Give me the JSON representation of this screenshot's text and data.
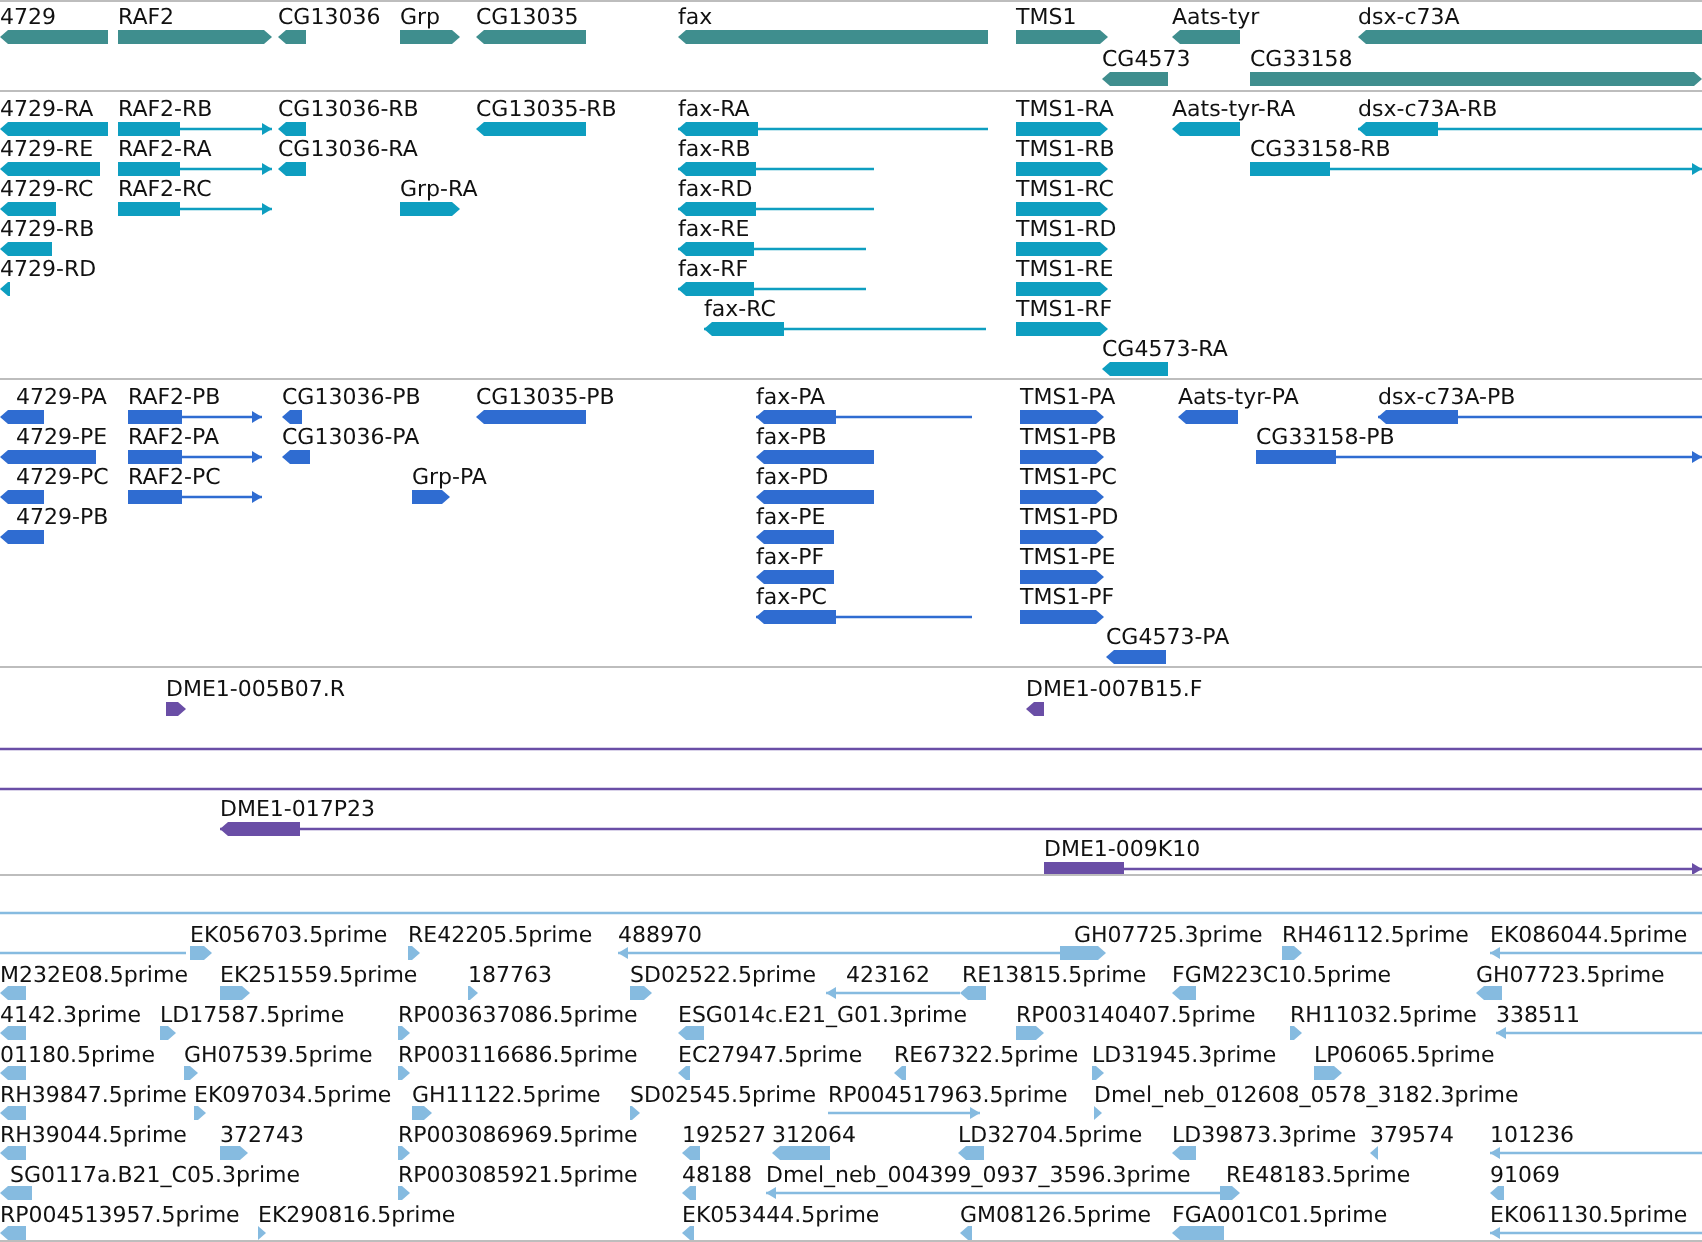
{
  "tracks": [
    {
      "kind": "gene",
      "color": "#3f8e8e",
      "features": [
        {
          "label": "4729",
          "reverse": true
        },
        {
          "label": "RAF2",
          "reverse": false
        },
        {
          "label": "CG13036",
          "reverse": true
        },
        {
          "label": "Grp",
          "reverse": false
        },
        {
          "label": "CG13035",
          "reverse": true
        },
        {
          "label": "fax",
          "reverse": true
        },
        {
          "label": "TMS1",
          "reverse": false
        },
        {
          "label": "Aats-tyr",
          "reverse": true
        },
        {
          "label": "dsx-c73A",
          "reverse": true
        },
        {
          "label": "CG4573",
          "reverse": true
        },
        {
          "label": "CG33158",
          "reverse": false
        }
      ]
    },
    {
      "kind": "transcript",
      "color": "#0e9ec0",
      "features": [
        {
          "label": "4729-RA",
          "reverse": true
        },
        {
          "label": "RAF2-RB",
          "reverse": false
        },
        {
          "label": "CG13036-RB",
          "reverse": true
        },
        {
          "label": "CG13035-RB",
          "reverse": true
        },
        {
          "label": "fax-RA",
          "reverse": true
        },
        {
          "label": "TMS1-RA",
          "reverse": false
        },
        {
          "label": "Aats-tyr-RA",
          "reverse": true
        },
        {
          "label": "dsx-c73A-RB",
          "reverse": true
        },
        {
          "label": "4729-RE",
          "reverse": true
        },
        {
          "label": "RAF2-RA",
          "reverse": false
        },
        {
          "label": "CG13036-RA",
          "reverse": true
        },
        {
          "label": "fax-RB",
          "reverse": true
        },
        {
          "label": "TMS1-RB",
          "reverse": false
        },
        {
          "label": "CG33158-RB",
          "reverse": false
        },
        {
          "label": "4729-RC",
          "reverse": true
        },
        {
          "label": "RAF2-RC",
          "reverse": false
        },
        {
          "label": "Grp-RA",
          "reverse": false
        },
        {
          "label": "fax-RD",
          "reverse": true
        },
        {
          "label": "TMS1-RC",
          "reverse": false
        },
        {
          "label": "4729-RB",
          "reverse": true
        },
        {
          "label": "fax-RE",
          "reverse": true
        },
        {
          "label": "TMS1-RD",
          "reverse": false
        },
        {
          "label": "4729-RD",
          "reverse": true
        },
        {
          "label": "fax-RF",
          "reverse": true
        },
        {
          "label": "TMS1-RE",
          "reverse": false
        },
        {
          "label": "fax-RC",
          "reverse": true
        },
        {
          "label": "TMS1-RF",
          "reverse": false
        },
        {
          "label": "CG4573-RA",
          "reverse": true
        }
      ]
    },
    {
      "kind": "protein",
      "color": "#2f6cd1",
      "features": [
        {
          "label": "4729-PA",
          "reverse": true
        },
        {
          "label": "RAF2-PB",
          "reverse": false
        },
        {
          "label": "CG13036-PB",
          "reverse": true
        },
        {
          "label": "CG13035-PB",
          "reverse": true
        },
        {
          "label": "fax-PA",
          "reverse": true
        },
        {
          "label": "TMS1-PA",
          "reverse": false
        },
        {
          "label": "Aats-tyr-PA",
          "reverse": true
        },
        {
          "label": "dsx-c73A-PB",
          "reverse": true
        },
        {
          "label": "4729-PE",
          "reverse": true
        },
        {
          "label": "RAF2-PA",
          "reverse": false
        },
        {
          "label": "CG13036-PA",
          "reverse": true
        },
        {
          "label": "fax-PB",
          "reverse": true
        },
        {
          "label": "TMS1-PB",
          "reverse": false
        },
        {
          "label": "CG33158-PB",
          "reverse": false
        },
        {
          "label": "4729-PC",
          "reverse": true
        },
        {
          "label": "RAF2-PC",
          "reverse": false
        },
        {
          "label": "Grp-PA",
          "reverse": false
        },
        {
          "label": "fax-PD",
          "reverse": true
        },
        {
          "label": "TMS1-PC",
          "reverse": false
        },
        {
          "label": "4729-PB",
          "reverse": true
        },
        {
          "label": "fax-PE",
          "reverse": true
        },
        {
          "label": "TMS1-PD",
          "reverse": false
        },
        {
          "label": "fax-PF",
          "reverse": true
        },
        {
          "label": "TMS1-PE",
          "reverse": false
        },
        {
          "label": "fax-PC",
          "reverse": true
        },
        {
          "label": "TMS1-PF",
          "reverse": false
        },
        {
          "label": "CG4573-PA",
          "reverse": true
        }
      ]
    },
    {
      "kind": "clone",
      "color": "#6a4ea6",
      "features": [
        {
          "kind": "feature",
          "label": "DME1-005B07.R",
          "reverse": false
        },
        {
          "kind": "feature",
          "label": "DME1-007B15.F",
          "reverse": true
        },
        {
          "kind": "span"
        },
        {
          "kind": "span"
        },
        {
          "kind": "feature",
          "label": "DME1-017P23",
          "reverse": true
        },
        {
          "kind": "feature",
          "label": "DME1-009K10",
          "reverse": false
        }
      ]
    },
    {
      "kind": "est",
      "color": "#86bbe0",
      "features": [
        {
          "kind": "span"
        },
        {
          "kind": "span"
        },
        {
          "kind": "feature",
          "label": "EK056703.5prime",
          "reverse": false
        },
        {
          "kind": "feature",
          "label": "RE42205.5prime",
          "reverse": false
        },
        {
          "kind": "feature",
          "label": "488970",
          "reverse": true
        },
        {
          "kind": "feature",
          "label": "GH07725.3prime",
          "reverse": false
        },
        {
          "kind": "feature",
          "label": "RH46112.5prime",
          "reverse": false
        },
        {
          "kind": "feature",
          "label": "EK086044.5prime",
          "reverse": true
        },
        {
          "kind": "feature",
          "label": "M232E08.5prime",
          "reverse": true
        },
        {
          "kind": "feature",
          "label": "EK251559.5prime",
          "reverse": false
        },
        {
          "kind": "feature",
          "label": "187763",
          "reverse": false
        },
        {
          "kind": "feature",
          "label": "SD02522.5prime",
          "reverse": false
        },
        {
          "kind": "feature",
          "label": "423162",
          "reverse": true
        },
        {
          "kind": "feature",
          "label": "RE13815.5prime",
          "reverse": true
        },
        {
          "kind": "feature",
          "label": "FGM223C10.5prime",
          "reverse": true
        },
        {
          "kind": "feature",
          "label": "GH07723.5prime",
          "reverse": true
        },
        {
          "kind": "feature",
          "label": "4142.3prime",
          "reverse": true
        },
        {
          "kind": "feature",
          "label": "LD17587.5prime",
          "reverse": false
        },
        {
          "kind": "feature",
          "label": "RP003637086.5prime",
          "reverse": false
        },
        {
          "kind": "feature",
          "label": "ESG014c.E21_G01.3prime",
          "reverse": true
        },
        {
          "kind": "feature",
          "label": "RP003140407.5prime",
          "reverse": false
        },
        {
          "kind": "feature",
          "label": "RH11032.5prime",
          "reverse": false
        },
        {
          "kind": "feature",
          "label": "338511",
          "reverse": true
        },
        {
          "kind": "feature",
          "label": "01180.5prime",
          "reverse": true
        },
        {
          "kind": "feature",
          "label": "GH07539.5prime",
          "reverse": false
        },
        {
          "kind": "feature",
          "label": "RP003116686.5prime",
          "reverse": false
        },
        {
          "kind": "feature",
          "label": "EC27947.5prime",
          "reverse": true
        },
        {
          "kind": "feature",
          "label": "RE67322.5prime",
          "reverse": true
        },
        {
          "kind": "feature",
          "label": "LD31945.3prime",
          "reverse": false
        },
        {
          "kind": "feature",
          "label": "LP06065.5prime",
          "reverse": false
        },
        {
          "kind": "feature",
          "label": "RH39847.5prime",
          "reverse": true
        },
        {
          "kind": "feature",
          "label": "EK097034.5prime",
          "reverse": false
        },
        {
          "kind": "feature",
          "label": "GH11122.5prime",
          "reverse": false
        },
        {
          "kind": "feature",
          "label": "SD02545.5prime",
          "reverse": false
        },
        {
          "kind": "feature",
          "label": "RP004517963.5prime",
          "reverse": false
        },
        {
          "kind": "feature",
          "label": "Dmel_neb_012608_0578_3182.3prime",
          "reverse": false
        },
        {
          "kind": "feature",
          "label": "RH39044.5prime",
          "reverse": true
        },
        {
          "kind": "feature",
          "label": "372743",
          "reverse": false
        },
        {
          "kind": "feature",
          "label": "RP003086969.5prime",
          "reverse": false
        },
        {
          "kind": "feature",
          "label": "192527",
          "reverse": true
        },
        {
          "kind": "feature",
          "label": "312064",
          "reverse": true
        },
        {
          "kind": "feature",
          "label": "LD32704.5prime",
          "reverse": true
        },
        {
          "kind": "feature",
          "label": "LD39873.3prime",
          "reverse": true
        },
        {
          "kind": "feature",
          "label": "379574",
          "reverse": true
        },
        {
          "kind": "feature",
          "label": "101236",
          "reverse": true
        },
        {
          "kind": "feature",
          "label": "SG0117a.B21_C05.3prime",
          "reverse": true
        },
        {
          "kind": "feature",
          "label": "RP003085921.5prime",
          "reverse": false
        },
        {
          "kind": "feature",
          "label": "48188",
          "reverse": true
        },
        {
          "kind": "feature",
          "label": "Dmel_neb_004399_0937_3596.3prime",
          "reverse": true
        },
        {
          "kind": "feature",
          "label": "RE48183.5prime",
          "reverse": false
        },
        {
          "kind": "feature",
          "label": "91069",
          "reverse": true
        },
        {
          "kind": "feature",
          "label": "RP004513957.5prime",
          "reverse": true
        },
        {
          "kind": "feature",
          "label": "EK290816.5prime",
          "reverse": false
        },
        {
          "kind": "feature",
          "label": "EK053444.5prime",
          "reverse": true
        },
        {
          "kind": "feature",
          "label": "GM08126.5prime",
          "reverse": true
        },
        {
          "kind": "feature",
          "label": "FGA001C01.5prime",
          "reverse": true
        },
        {
          "kind": "feature",
          "label": "EK061130.5prime",
          "reverse": true
        }
      ]
    }
  ]
}
